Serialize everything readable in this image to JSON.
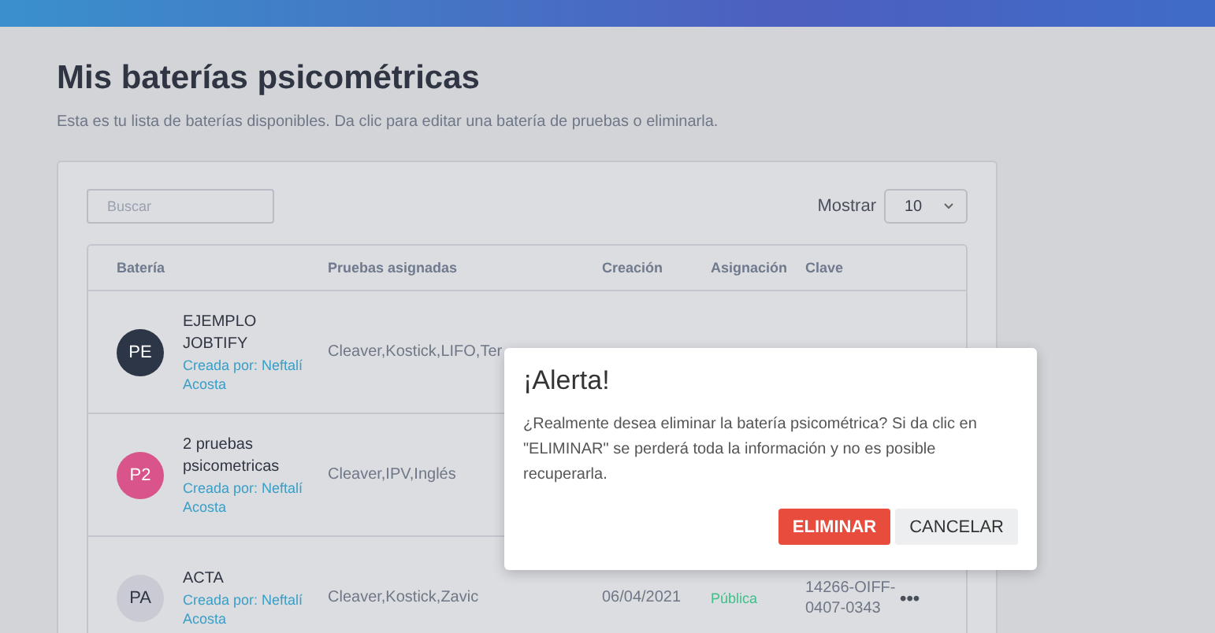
{
  "page": {
    "title": "Mis baterías psicométricas",
    "subtitle": "Esta es tu lista de baterías disponibles. Da clic para editar una batería de pruebas o eliminarla."
  },
  "search": {
    "placeholder": "Buscar"
  },
  "show": {
    "label": "Mostrar",
    "value": "10"
  },
  "table": {
    "columns": [
      "Batería",
      "Pruebas asignadas",
      "Creación",
      "Asignación",
      "Clave"
    ],
    "rows": [
      {
        "initials": "PE",
        "color": "#2d3646",
        "name": "EJEMPLO JOBTIFY",
        "creator": "Creada por: Neftalí Acosta",
        "tests": "Cleaver,Kostick,LIFO,Ter"
      },
      {
        "initials": "P2",
        "color": "#d9548a",
        "name": "2 pruebas psicometricas",
        "creator": "Creada por: Neftalí Acosta",
        "tests": "Cleaver,IPV,Inglés"
      },
      {
        "initials": "PA",
        "color": "#c9cad4",
        "name": "ACTA",
        "creator": "Creada por: Neftalí Acosta",
        "tests": "Cleaver,Kostick,Zavic",
        "created": "06/04/2021",
        "assignment": "Pública",
        "key": "14266-OIFF-0407-0343",
        "menu": "•••"
      }
    ]
  },
  "dialog": {
    "title": "¡Alerta!",
    "message": "¿Realmente desea eliminar la batería psicométrica? Si da clic en \"ELIMINAR\" se perderá toda la información y no es posible recuperarla.",
    "buttons": [
      {
        "label": "ELIMINAR",
        "kind": "danger"
      },
      {
        "label": "CANCELAR",
        "kind": "default"
      }
    ]
  }
}
